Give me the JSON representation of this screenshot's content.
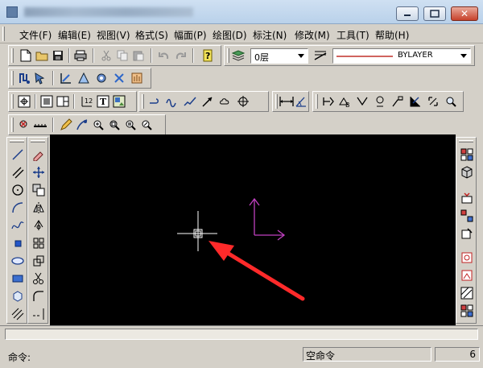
{
  "menu": {
    "items": [
      "文件(F)",
      "编辑(E)",
      "视图(V)",
      "格式(S)",
      "幅面(P)",
      "绘图(D)",
      "标注(N)",
      "修改(M)",
      "工具(T)",
      "帮助(H)"
    ]
  },
  "layer": {
    "value": "0层"
  },
  "linetype": {
    "value": "BYLAYER"
  },
  "command": {
    "label": "命令:",
    "value": ""
  },
  "status": {
    "state": "空命令",
    "right_text": "6"
  },
  "colors": {
    "canvas_bg": "#000000",
    "ucs_axis": "#c040c0",
    "arrow": "#ff2a2a",
    "crosshair": "#ffffff",
    "linetype_line": "#c0302a"
  },
  "icons": {
    "standard": [
      "new-file-icon",
      "open-folder-icon",
      "save-icon",
      "print-icon",
      "cut-icon",
      "copy-icon",
      "paste-icon",
      "undo-icon",
      "redo-icon",
      "help-icon",
      "layer-manager-icon",
      "line-properties-icon"
    ],
    "draw": [
      "line-icon",
      "construction-line-icon",
      "circle-icon",
      "arc-icon",
      "spline-icon",
      "rectangle-icon",
      "ellipse-icon",
      "text-icon",
      "polygon-icon",
      "hatch-icon"
    ],
    "modify": [
      "erase-icon",
      "move-icon",
      "copy-object-icon",
      "mirror-icon",
      "rotate-icon",
      "array-icon",
      "scale-icon",
      "trim-icon",
      "fillet-icon",
      "extend-icon"
    ]
  }
}
